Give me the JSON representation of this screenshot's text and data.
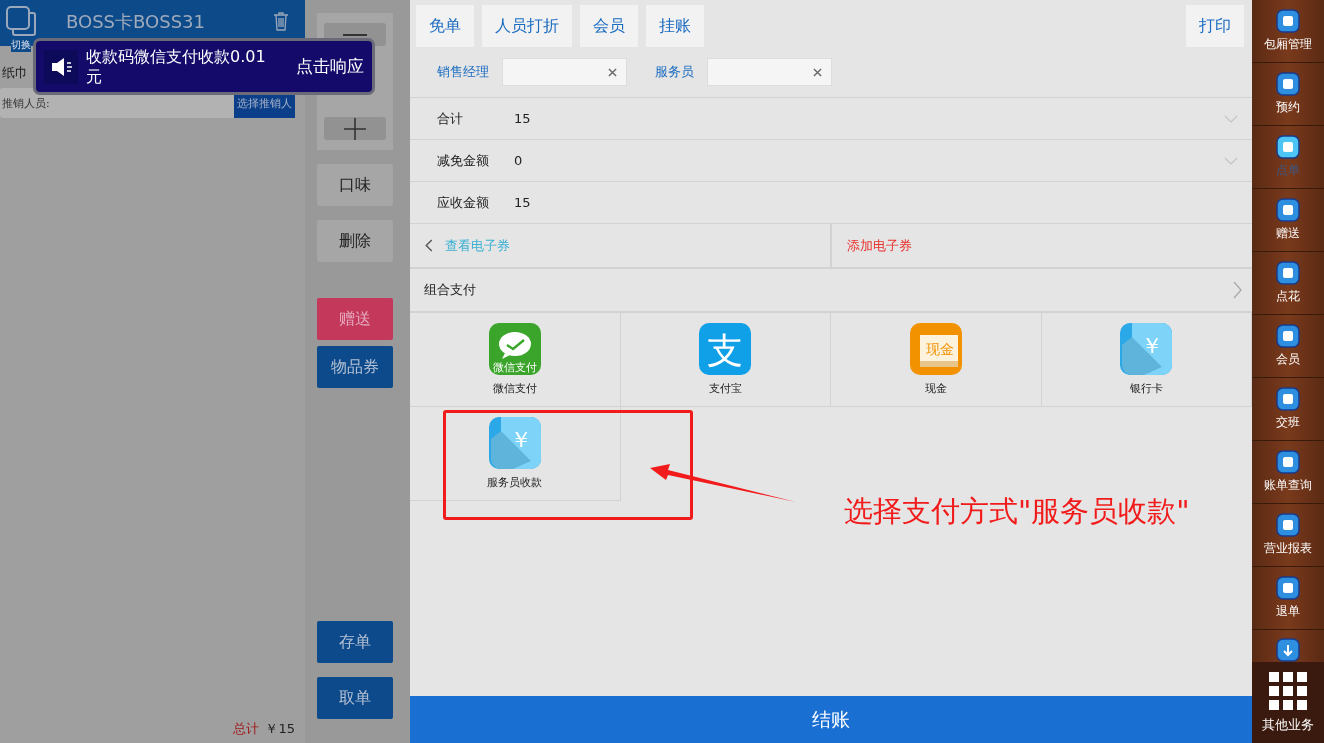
{
  "left_panel": {
    "switch_label": "切换",
    "title": "BOSS卡BOSS31",
    "item_label": "纸巾",
    "promoter": {
      "label": "推销人员:",
      "button": "选择推销人"
    },
    "total": {
      "label": "总计",
      "value": "￥15"
    }
  },
  "toast": {
    "message": "收款码微信支付收款0.01元",
    "action": "点击响应"
  },
  "side_actions": [
    {
      "label": "口味",
      "kind": "plain"
    },
    {
      "label": "删除",
      "kind": "plain"
    },
    {
      "label": "赠送",
      "kind": "gift"
    },
    {
      "label": "物品券",
      "kind": "primary"
    }
  ],
  "bottom_actions": [
    "存单",
    "取单"
  ],
  "toolbar": {
    "buttons": [
      "免单",
      "人员打折",
      "会员",
      "挂账"
    ],
    "print": "打印"
  },
  "staff_fields": [
    {
      "label": "销售经理"
    },
    {
      "label": "服务员"
    }
  ],
  "summary": [
    {
      "label": "合计",
      "value": "15",
      "expandable": true
    },
    {
      "label": "减免金额",
      "value": "0",
      "expandable": true
    },
    {
      "label": "应收金额",
      "value": "15",
      "expandable": false
    }
  ],
  "coupons": {
    "view": "查看电子券",
    "add": "添加电子券"
  },
  "combined_payment": "组合支付",
  "payment_methods": [
    {
      "kind": "wechat",
      "label": "微信支付",
      "icon_text": "微信支付"
    },
    {
      "kind": "alipay",
      "label": "支付宝",
      "icon_text": "支"
    },
    {
      "kind": "cash",
      "label": "现金",
      "icon_text": "现金"
    },
    {
      "kind": "card",
      "label": "银行卡",
      "icon_text": "￥"
    },
    {
      "kind": "card",
      "label": "服务员收款",
      "icon_text": "￥"
    }
  ],
  "annotation": "选择支付方式\"服务员收款\"",
  "checkout": "结账",
  "sidebar": {
    "items": [
      {
        "label": "包厢管理",
        "selected": false
      },
      {
        "label": "预约",
        "selected": false
      },
      {
        "label": "点单",
        "selected": true
      },
      {
        "label": "赠送",
        "selected": false
      },
      {
        "label": "点花",
        "selected": false
      },
      {
        "label": "会员",
        "selected": false
      },
      {
        "label": "交班",
        "selected": false
      },
      {
        "label": "账单查询",
        "selected": false
      },
      {
        "label": "营业报表",
        "selected": false
      },
      {
        "label": "退单",
        "selected": false
      }
    ],
    "more": "其他业务"
  }
}
